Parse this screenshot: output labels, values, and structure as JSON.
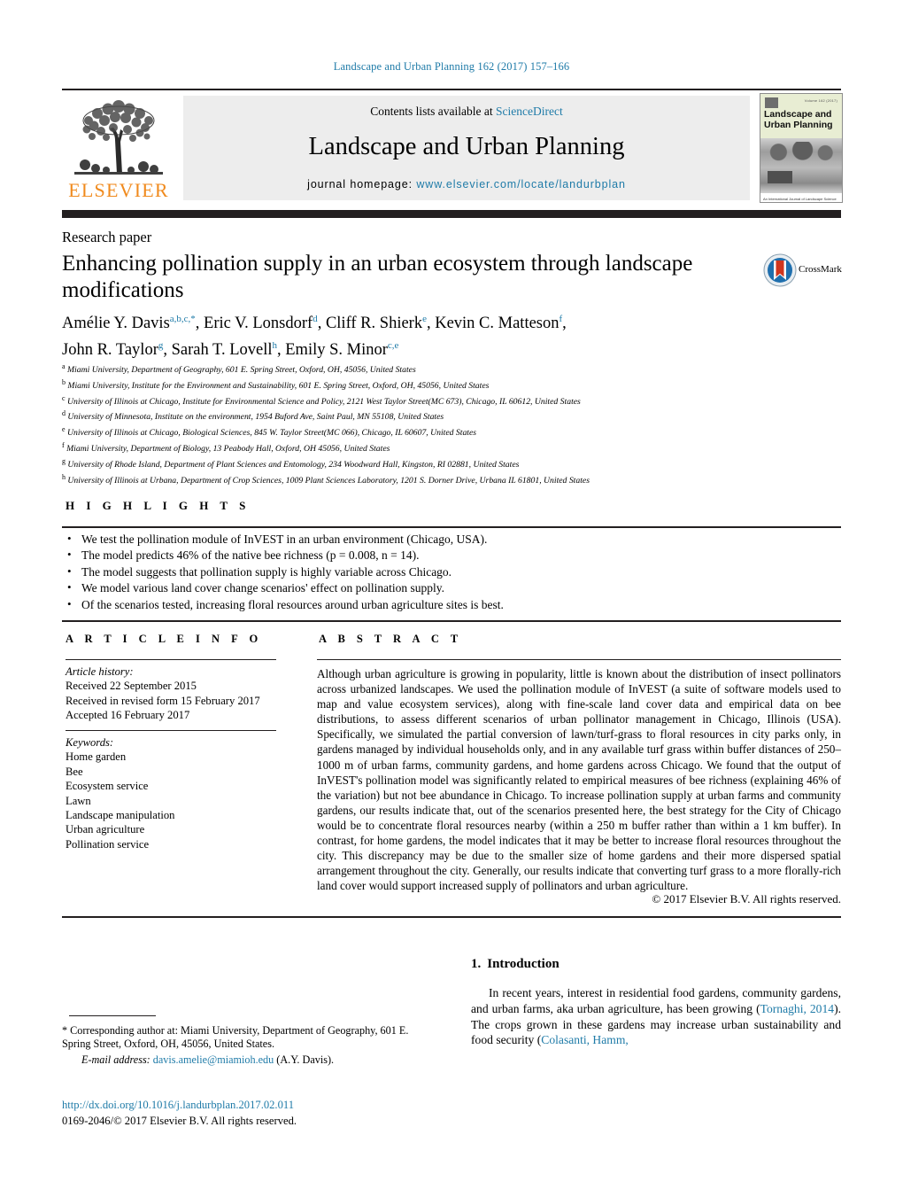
{
  "running_head": "Landscape and Urban Planning 162 (2017) 157–166",
  "masthead": {
    "contents_prefix": "Contents lists available at ",
    "sciencedirect": "ScienceDirect",
    "journal_title": "Landscape and Urban Planning",
    "homepage_label": "journal homepage:",
    "homepage_url": "www.elsevier.com/locate/landurbplan",
    "publisher_wordmark": "ELSEVIER",
    "cover": {
      "title_line1": "Landscape and",
      "title_line2": "Urban Planning",
      "top_note": "Volume 162 (2017)",
      "footer_note": "An International Journal of Landscape Science"
    }
  },
  "article": {
    "type": "Research paper",
    "title": "Enhancing pollination supply in an urban ecosystem through landscape modifications",
    "crossmark_label": "CrossMark",
    "authors_line1": "Amélie Y. Davis",
    "authors": [
      {
        "name": "Amélie Y. Davis",
        "sup": "a,b,c,*"
      },
      {
        "name": "Eric V. Lonsdorf",
        "sup": "d"
      },
      {
        "name": "Cliff R. Shierk",
        "sup": "e"
      },
      {
        "name": "Kevin C. Matteson",
        "sup": "f"
      },
      {
        "name": "John R. Taylor",
        "sup": "g"
      },
      {
        "name": "Sarah T. Lovell",
        "sup": "h"
      },
      {
        "name": "Emily S. Minor",
        "sup": "c,e"
      }
    ],
    "affiliations": [
      {
        "marker": "a",
        "text": "Miami University, Department of Geography, 601 E. Spring Street, Oxford, OH, 45056, United States"
      },
      {
        "marker": "b",
        "text": "Miami University, Institute for the Environment and Sustainability, 601 E. Spring Street, Oxford, OH, 45056, United States"
      },
      {
        "marker": "c",
        "text": "University of Illinois at Chicago, Institute for Environmental Science and Policy, 2121 West Taylor Street(MC 673), Chicago, IL 60612, United States"
      },
      {
        "marker": "d",
        "text": "University of Minnesota, Institute on the environment, 1954 Buford Ave, Saint Paul, MN 55108, United States"
      },
      {
        "marker": "e",
        "text": "University of Illinois at Chicago, Biological Sciences, 845 W. Taylor Street(MC 066), Chicago, IL 60607, United States"
      },
      {
        "marker": "f",
        "text": "Miami University, Department of Biology, 13 Peabody Hall, Oxford, OH 45056, United States"
      },
      {
        "marker": "g",
        "text": "University of Rhode Island, Department of Plant Sciences and Entomology, 234 Woodward Hall, Kingston, RI 02881, United States"
      },
      {
        "marker": "h",
        "text": "University of Illinois at Urbana, Department of Crop Sciences, 1009 Plant Sciences Laboratory, 1201 S. Dorner Drive, Urbana IL 61801, United States"
      }
    ]
  },
  "highlights": {
    "heading": "H I G H L I G H T S",
    "items": [
      "We test the pollination module of InVEST in an urban environment (Chicago, USA).",
      "The model predicts 46% of the native bee richness (p = 0.008, n = 14).",
      "The model suggests that pollination supply is highly variable across Chicago.",
      "We model various land cover change scenarios' effect on pollination supply.",
      "Of the scenarios tested, increasing floral resources around urban agriculture sites is best."
    ]
  },
  "article_info": {
    "heading": "A R T I C L E   I N F O",
    "history_label": "Article history:",
    "history": [
      "Received 22 September 2015",
      "Received in revised form 15 February 2017",
      "Accepted 16 February 2017"
    ],
    "keywords_label": "Keywords:",
    "keywords": [
      "Home garden",
      "Bee",
      "Ecosystem service",
      "Lawn",
      "Landscape manipulation",
      "Urban agriculture",
      "Pollination service"
    ]
  },
  "abstract": {
    "heading": "A B S T R A C T",
    "text": "Although urban agriculture is growing in popularity, little is known about the distribution of insect pollinators across urbanized landscapes. We used the pollination module of InVEST (a suite of software models used to map and value ecosystem services), along with fine-scale land cover data and empirical data on bee distributions, to assess different scenarios of urban pollinator management in Chicago, Illinois (USA). Specifically, we simulated the partial conversion of lawn/turf-grass to floral resources in city parks only, in gardens managed by individual households only, and in any available turf grass within buffer distances of 250–1000 m of urban farms, community gardens, and home gardens across Chicago. We found that the output of InVEST's pollination model was significantly related to empirical measures of bee richness (explaining 46% of the variation) but not bee abundance in Chicago. To increase pollination supply at urban farms and community gardens, our results indicate that, out of the scenarios presented here, the best strategy for the City of Chicago would be to concentrate floral resources nearby (within a 250 m buffer rather than within a 1 km buffer). In contrast, for home gardens, the model indicates that it may be better to increase floral resources throughout the city. This discrepancy may be due to the smaller size of home gardens and their more dispersed spatial arrangement throughout the city. Generally, our results indicate that converting turf grass to a more florally-rich land cover would support increased supply of pollinators and urban agriculture.",
    "copyright": "© 2017 Elsevier B.V. All rights reserved."
  },
  "introduction": {
    "number": "1.",
    "heading": "Introduction",
    "paragraph_part1": "In recent years, interest in residential food gardens, community gardens, and urban farms, aka urban agriculture, has been growing (",
    "citation1": "Tornaghi, 2014",
    "paragraph_part2": "). The crops grown in these gardens may increase urban sustainability and food security (",
    "citation2": "Colasanti, Hamm,"
  },
  "footnote": {
    "corresponding": "* Corresponding author at: Miami University, Department of Geography, 601 E. Spring Street, Oxford, OH, 45056, United States.",
    "email_label": "E-mail address:",
    "email": "davis.amelie@miamioh.edu",
    "email_suffix": "(A.Y. Davis).",
    "doi": "http://dx.doi.org/10.1016/j.landurbplan.2017.02.011",
    "issn_line": "0169-2046/© 2017 Elsevier B.V. All rights reserved."
  },
  "colors": {
    "link_blue": "#1f7ba8",
    "elsevier_orange": "#f08a1d",
    "rule_black": "#231f20",
    "banner_gray": "#ededed"
  }
}
